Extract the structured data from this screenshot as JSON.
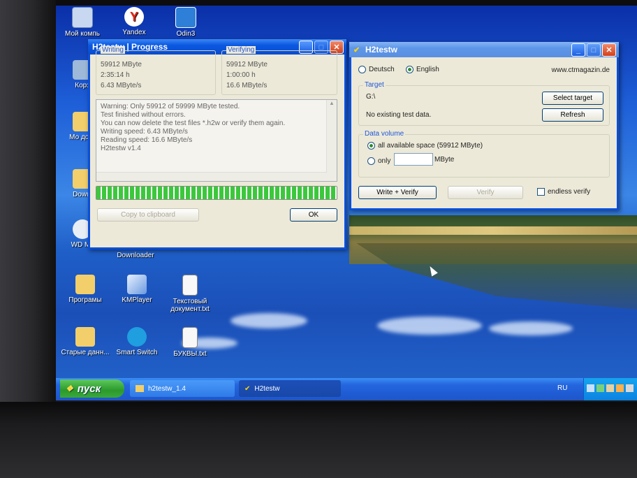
{
  "desktop": {
    "icons": [
      {
        "label": "Мой компь",
        "icon": "my-computer-icon"
      },
      {
        "label": "Yandex",
        "icon": "yandex-icon"
      },
      {
        "label": "Odin3",
        "icon": "odin-icon"
      },
      {
        "label": "Корз",
        "icon": "recycle-bin-icon"
      },
      {
        "label": "Мо доку",
        "icon": "folder-icon"
      },
      {
        "label": "Downl",
        "icon": "folder-icon"
      },
      {
        "label": "WD My",
        "icon": "cloud-icon"
      },
      {
        "label": "Downloader",
        "icon": "app-icon"
      },
      {
        "label": "Програмы",
        "icon": "folder-icon"
      },
      {
        "label": "KMPlayer",
        "icon": "kmplayer-icon"
      },
      {
        "label": "Текстовый документ.txt",
        "icon": "text-file-icon"
      },
      {
        "label": "Старые данн...",
        "icon": "folder-icon"
      },
      {
        "label": "Smart Switch",
        "icon": "smart-switch-icon"
      },
      {
        "label": "БУКВЫ.txt",
        "icon": "text-file-icon"
      }
    ]
  },
  "progress_window": {
    "title": "H2testw | Progress",
    "writing": {
      "legend": "Writing",
      "size": "59912 MByte",
      "time": "2:35:14 h",
      "speed": "6.43 MByte/s"
    },
    "verifying": {
      "legend": "Verifying",
      "size": "59912 MByte",
      "time": "1:00:00 h",
      "speed": "16.6 MByte/s"
    },
    "log_lines": [
      "Warning: Only 59912 of 59999 MByte tested.",
      "Test finished without errors.",
      "You can now delete the test files *.h2w or verify them again.",
      "Writing speed: 6.43 MByte/s",
      "Reading speed: 16.6 MByte/s",
      "H2testw v1.4"
    ],
    "progress": 1.0,
    "copy_button": "Copy to clipboard",
    "ok_button": "OK"
  },
  "main_window": {
    "title": "H2testw",
    "lang_deutsch": "Deutsch",
    "lang_english": "English",
    "selected_language": "English",
    "website": "www.ctmagazin.de",
    "target_legend": "Target",
    "target_path": "G:\\",
    "target_status": "No existing test data.",
    "select_target_button": "Select target",
    "refresh_button": "Refresh",
    "volume_legend": "Data volume",
    "option_all": "all available space (59912 MByte)",
    "option_only": "only",
    "only_unit": "MByte",
    "only_value": "",
    "write_verify_button": "Write + Verify",
    "verify_button": "Verify",
    "endless_verify": "endless verify"
  },
  "taskbar": {
    "start_label": "пуск",
    "items": [
      {
        "label": "h2testw_1.4"
      },
      {
        "label": "H2testw"
      }
    ],
    "language": "RU"
  },
  "colors": {
    "titlebar": "#0a58e0",
    "progress_green": "#3cc83c",
    "legend_blue": "#1f55d8"
  }
}
